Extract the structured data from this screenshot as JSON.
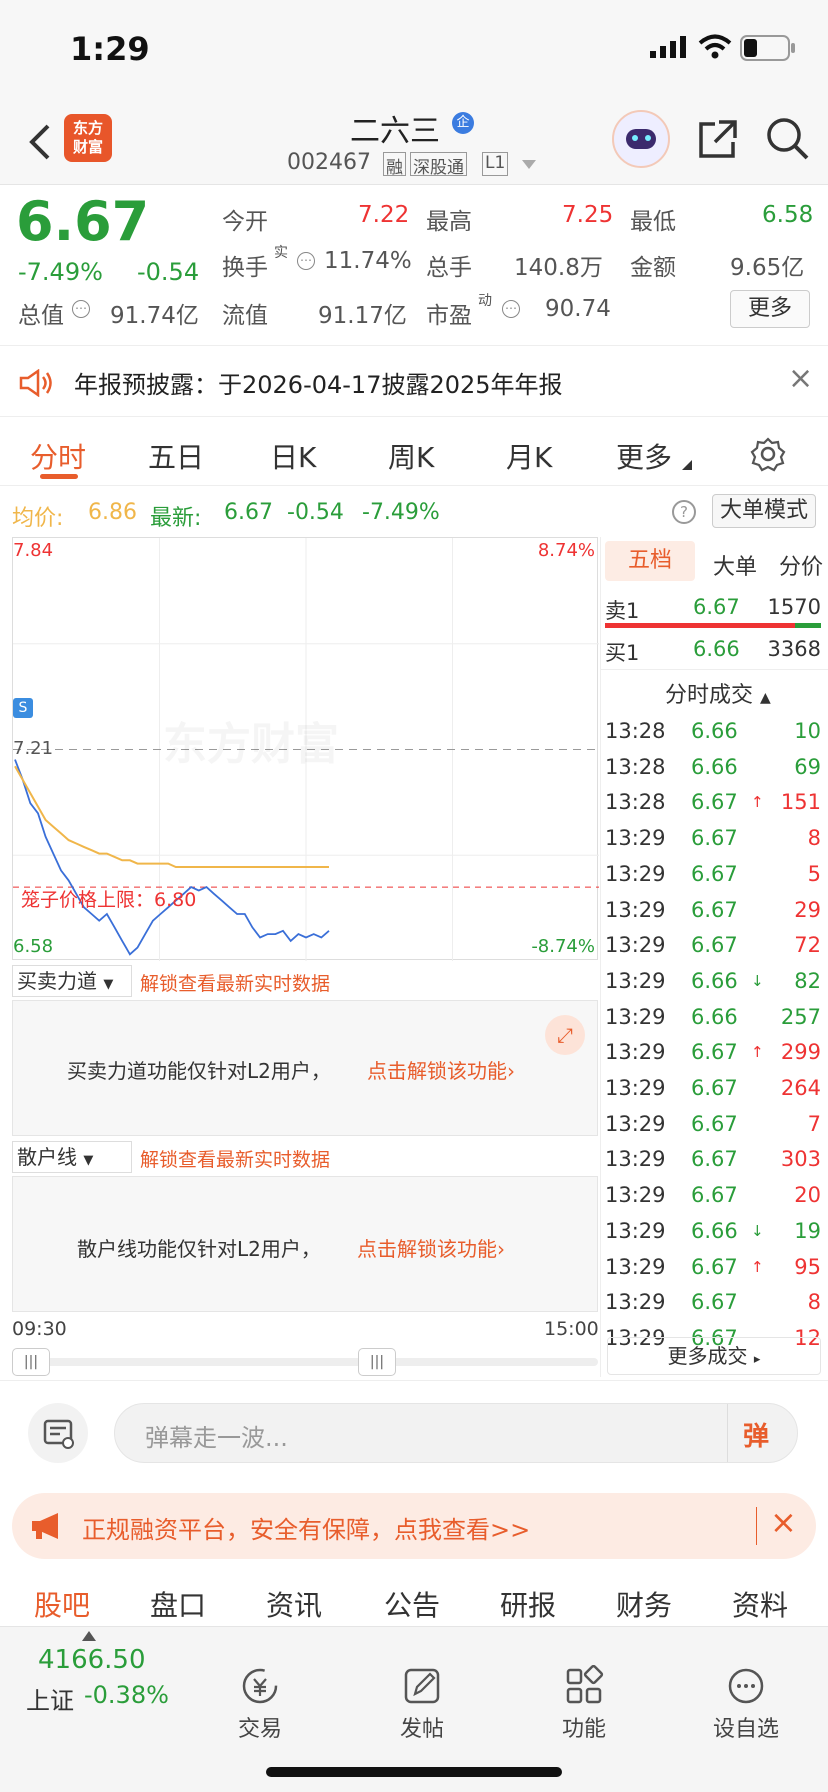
{
  "status": {
    "time": "1:29"
  },
  "header": {
    "logo_text": "东方\n财富",
    "stock_name": "二六三",
    "stock_code": "002467",
    "badges": [
      "融",
      "深股通",
      "L1"
    ],
    "corp_badge": "企"
  },
  "quote": {
    "price": "6.67",
    "change_pct": "-7.49%",
    "change": "-0.54",
    "rows": [
      [
        {
          "label": "今开",
          "value": "7.22",
          "color": "red"
        },
        {
          "label": "最高",
          "value": "7.25",
          "color": "red"
        },
        {
          "label": "最低",
          "value": "6.58",
          "color": "green"
        }
      ],
      [
        {
          "label": "换手",
          "sup": "实",
          "value": "11.74%",
          "color": "gray"
        },
        {
          "label": "总手",
          "value": "140.8万",
          "color": "gray"
        },
        {
          "label": "金额",
          "value": "9.65亿",
          "color": "gray"
        }
      ],
      [
        {
          "label": "总值",
          "value": "91.74亿",
          "color": "gray"
        },
        {
          "label": "流值",
          "value": "91.17亿",
          "color": "gray"
        },
        {
          "label": "市盈",
          "sup": "动",
          "value": "90.74",
          "color": "gray"
        }
      ]
    ],
    "more_label": "更多"
  },
  "notice": {
    "text": "年报预披露：于2026-04-17披露2025年年报"
  },
  "tabs": [
    {
      "label": "分时",
      "active": true
    },
    {
      "label": "五日"
    },
    {
      "label": "日K"
    },
    {
      "label": "周K"
    },
    {
      "label": "月K"
    },
    {
      "label": "更多"
    }
  ],
  "indicator": {
    "avg_label": "均价:",
    "avg_value": "6.86",
    "latest_label": "最新:",
    "latest_value": "6.67",
    "latest_change": "-0.54",
    "latest_pct": "-7.49%",
    "mode_button": "大单模式"
  },
  "chart_data": {
    "type": "line",
    "y_top_label": "7.84",
    "y_bottom_label": "6.58",
    "pct_top_label": "8.74%",
    "pct_bottom_label": "-8.74%",
    "prev_close_label": "7.21",
    "limit_label": "笼子价格上限：6.80",
    "watermark": "东方财富",
    "s_marker": "S",
    "x_start": "09:30",
    "x_end": "15:00",
    "ylim": [
      6.58,
      7.84
    ],
    "series": [
      {
        "values": [
          7.18,
          7.12,
          7.05,
          7.02,
          6.95,
          6.9,
          6.85,
          6.82,
          6.78,
          6.74,
          6.72,
          6.7,
          6.72,
          6.68,
          6.64,
          6.6,
          6.62,
          6.66,
          6.7,
          6.72,
          6.74,
          6.76,
          6.78,
          6.8,
          6.79,
          6.8,
          6.78,
          6.76,
          6.74,
          6.72,
          6.72,
          6.68,
          6.65,
          6.66,
          6.66,
          6.67,
          6.64,
          6.66,
          6.65,
          6.66,
          6.65,
          6.67
        ]
      },
      {
        "values": [
          7.16,
          7.12,
          7.08,
          7.04,
          7.0,
          6.98,
          6.96,
          6.94,
          6.93,
          6.92,
          6.91,
          6.9,
          6.9,
          6.89,
          6.88,
          6.88,
          6.87,
          6.87,
          6.87,
          6.87,
          6.87,
          6.86,
          6.86,
          6.86,
          6.86,
          6.86,
          6.86,
          6.86,
          6.86,
          6.86,
          6.86,
          6.86,
          6.86,
          6.86,
          6.86,
          6.86,
          6.86,
          6.86,
          6.86,
          6.86,
          6.86,
          6.86
        ]
      }
    ]
  },
  "panels": [
    {
      "select": "买卖力道",
      "unlock": "解锁查看最新实时数据",
      "msg": "买卖力道功能仅针对L2用户，",
      "link": "点击解锁该功能"
    },
    {
      "select": "散户线",
      "unlock": "解锁查看最新实时数据",
      "msg": "散户线功能仅针对L2用户，",
      "link": "点击解锁该功能"
    }
  ],
  "orderbook": {
    "tabs": [
      "五档",
      "大单",
      "分价"
    ],
    "sell1": {
      "label": "卖1",
      "price": "6.67",
      "vol": "1570"
    },
    "buy1": {
      "label": "买1",
      "price": "6.66",
      "vol": "3368"
    },
    "ticks_title": "分时成交",
    "ticks": [
      {
        "t": "13:28",
        "p": "6.66",
        "v": "10",
        "dir": ""
      },
      {
        "t": "13:28",
        "p": "6.66",
        "v": "69",
        "dir": ""
      },
      {
        "t": "13:28",
        "p": "6.67",
        "v": "151",
        "dir": "↑"
      },
      {
        "t": "13:29",
        "p": "6.67",
        "v": "8",
        "dir": ""
      },
      {
        "t": "13:29",
        "p": "6.67",
        "v": "5",
        "dir": ""
      },
      {
        "t": "13:29",
        "p": "6.67",
        "v": "29",
        "dir": ""
      },
      {
        "t": "13:29",
        "p": "6.67",
        "v": "72",
        "dir": ""
      },
      {
        "t": "13:29",
        "p": "6.66",
        "v": "82",
        "dir": "↓"
      },
      {
        "t": "13:29",
        "p": "6.66",
        "v": "257",
        "dir": ""
      },
      {
        "t": "13:29",
        "p": "6.67",
        "v": "299",
        "dir": "↑"
      },
      {
        "t": "13:29",
        "p": "6.67",
        "v": "264",
        "dir": ""
      },
      {
        "t": "13:29",
        "p": "6.67",
        "v": "7",
        "dir": ""
      },
      {
        "t": "13:29",
        "p": "6.67",
        "v": "303",
        "dir": ""
      },
      {
        "t": "13:29",
        "p": "6.67",
        "v": "20",
        "dir": ""
      },
      {
        "t": "13:29",
        "p": "6.66",
        "v": "19",
        "dir": "↓"
      },
      {
        "t": "13:29",
        "p": "6.67",
        "v": "95",
        "dir": "↑"
      },
      {
        "t": "13:29",
        "p": "6.67",
        "v": "8",
        "dir": ""
      },
      {
        "t": "13:29",
        "p": "6.67",
        "v": "12",
        "dir": ""
      }
    ],
    "more_label": "更多成交"
  },
  "comment": {
    "placeholder": "弹幕走一波...",
    "send_label": "弹"
  },
  "ad": {
    "text": "正规融资平台，安全有保障，点我查看>>"
  },
  "bottom_tabs": [
    "股吧",
    "盘口",
    "资讯",
    "公告",
    "研报",
    "财务",
    "资料"
  ],
  "footer": {
    "index_value": "4166.50",
    "index_name": "上证",
    "index_change": "-0.38%",
    "items": [
      {
        "label": "交易",
        "icon": "trade-icon"
      },
      {
        "label": "发帖",
        "icon": "post-icon"
      },
      {
        "label": "功能",
        "icon": "function-icon"
      },
      {
        "label": "设自选",
        "icon": "add-watch-icon"
      }
    ]
  },
  "colors": {
    "red": "#e33333",
    "green": "#2a9d3a",
    "orange": "#e85d2c",
    "avg_line": "#f0b64a",
    "price_line": "#3a6fd8"
  }
}
